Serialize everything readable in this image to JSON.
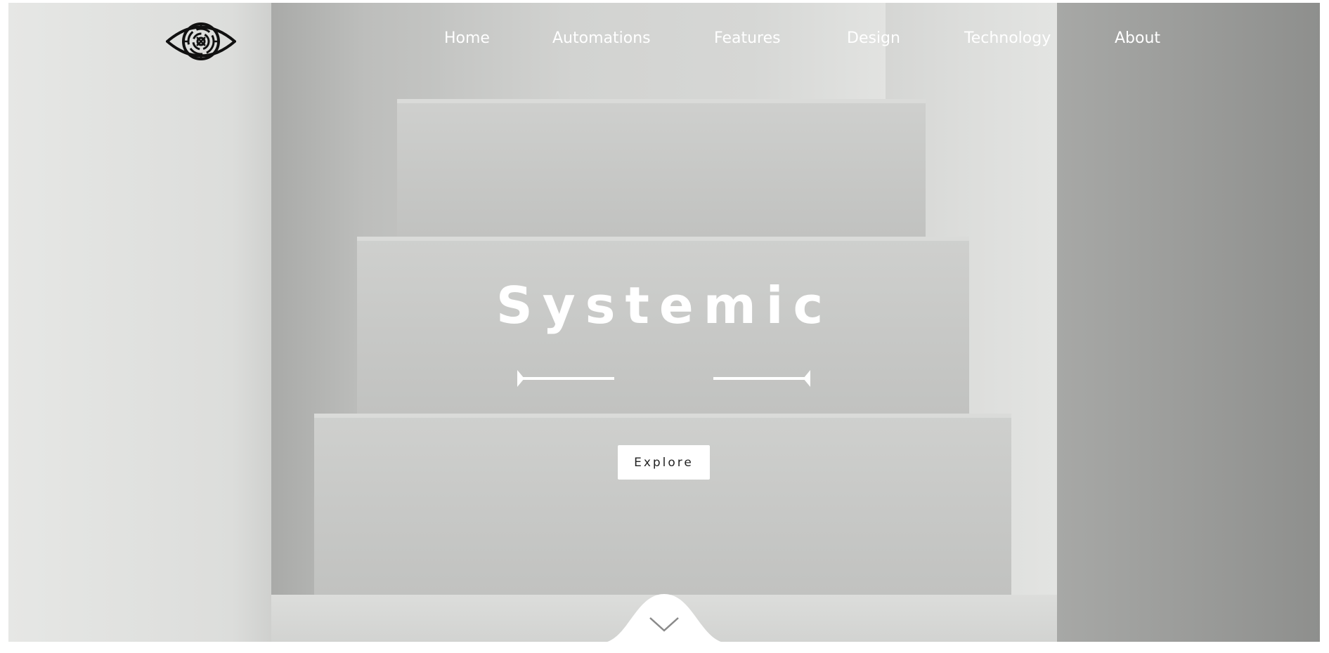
{
  "brand": {
    "logo_icon": "eye-maze-icon"
  },
  "nav": {
    "items": [
      {
        "label": "Home"
      },
      {
        "label": "Automations"
      },
      {
        "label": "Features"
      },
      {
        "label": "Design"
      },
      {
        "label": "Technology"
      },
      {
        "label": "About"
      }
    ]
  },
  "hero": {
    "title": "Systemic",
    "cta_label": "Explore",
    "scroll_icon": "chevron-down-icon"
  },
  "colors": {
    "nav_text": "#ffffff",
    "title_text": "#ffffff",
    "button_bg": "#ffffff",
    "button_text": "#222222"
  }
}
